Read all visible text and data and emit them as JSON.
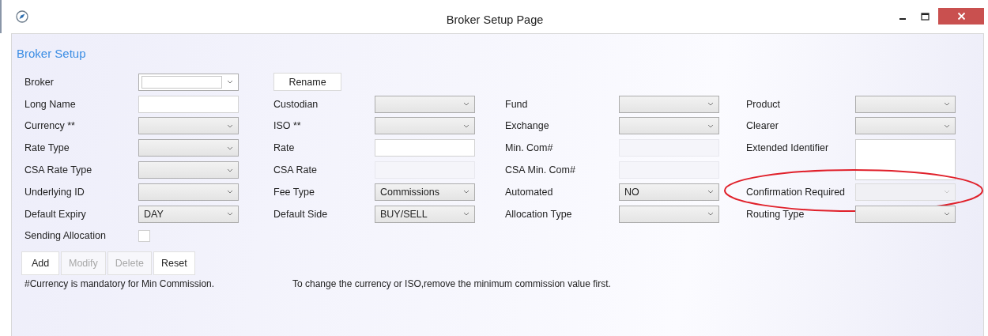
{
  "window": {
    "title": "Broker Setup Page"
  },
  "heading": "Broker Setup",
  "rows": [
    [
      {
        "label": "Broker",
        "kind": "combo",
        "editable": true
      },
      {
        "kind": "button",
        "label": "Rename"
      }
    ],
    [
      {
        "label": "Long Name",
        "kind": "text",
        "disabled": false
      },
      {
        "label": "Custodian",
        "kind": "combo"
      },
      {
        "label": "Fund",
        "kind": "combo"
      },
      {
        "label": "Product",
        "kind": "combo"
      }
    ],
    [
      {
        "label": "Currency **",
        "kind": "combo"
      },
      {
        "label": "ISO **",
        "kind": "combo"
      },
      {
        "label": "Exchange",
        "kind": "combo"
      },
      {
        "label": "Clearer",
        "kind": "combo"
      }
    ],
    [
      {
        "label": "Rate Type",
        "kind": "combo"
      },
      {
        "label": "Rate",
        "kind": "text",
        "disabled": false
      },
      {
        "label": "Min. Com#",
        "kind": "text",
        "disabled": true
      },
      {
        "label": "Extended Identifier",
        "kind": "textarea"
      }
    ],
    [
      {
        "label": "CSA Rate Type",
        "kind": "combo"
      },
      {
        "label": "CSA Rate",
        "kind": "text",
        "disabled": true
      },
      {
        "label": "CSA Min. Com#",
        "kind": "text",
        "disabled": true
      }
    ],
    [
      {
        "label": "Underlying ID",
        "kind": "combo"
      },
      {
        "label": "Fee Type",
        "kind": "combo",
        "value": "Commissions"
      },
      {
        "label": "Automated",
        "kind": "combo",
        "value": "NO"
      },
      {
        "label": "Confirmation Required",
        "kind": "combo",
        "disabled": true,
        "highlight": true
      }
    ],
    [
      {
        "label": "Default Expiry",
        "kind": "combo",
        "value": "DAY"
      },
      {
        "label": "Default Side",
        "kind": "combo",
        "value": "BUY/SELL"
      },
      {
        "label": "Allocation Type",
        "kind": "combo"
      },
      {
        "label": "Routing Type",
        "kind": "combo"
      }
    ],
    [
      {
        "label": "Sending Allocation",
        "kind": "checkbox",
        "checked": false
      }
    ]
  ],
  "buttons": [
    {
      "label": "Add",
      "disabled": false
    },
    {
      "label": "Modify",
      "disabled": true
    },
    {
      "label": "Delete",
      "disabled": true
    },
    {
      "label": "Reset",
      "disabled": false
    }
  ],
  "notes": [
    "#Currency is mandatory for Min Commission.",
    "To change the currency or ISO,remove the minimum commission value first."
  ]
}
